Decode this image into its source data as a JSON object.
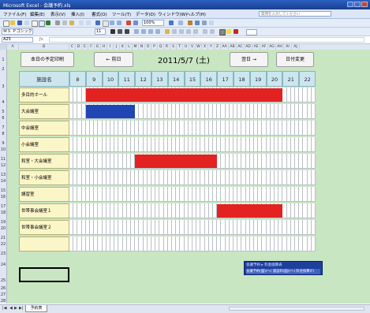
{
  "window": {
    "title": "Microsoft Excel - 会議予約.xls"
  },
  "menu": [
    "ファイル(F)",
    "編集(E)",
    "表示(V)",
    "挿入(I)",
    "書式(O)",
    "ツール(T)",
    "データ(D)",
    "ウィンドウ(W)",
    "ヘルプ(H)"
  ],
  "help_placeholder": "質問を入力してください",
  "toolbar": {
    "zoom": "100%",
    "font": "ＭＳ Ｐゴシック",
    "size": "11"
  },
  "formula": {
    "name_box": "A25"
  },
  "columns": [
    "A",
    "B",
    "C",
    "D",
    "E",
    "F",
    "G",
    "H",
    "I",
    "J",
    "K",
    "L",
    "M",
    "N",
    "O",
    "P",
    "Q",
    "R",
    "S",
    "T",
    "U",
    "V",
    "W",
    "X",
    "Y",
    "Z",
    "AA",
    "AB",
    "AC",
    "AD",
    "AE",
    "AF",
    "AG",
    "AH",
    "AI",
    "AJ"
  ],
  "rows": [
    "1",
    "2",
    "3",
    "4",
    "5",
    "6",
    "7",
    "8",
    "9",
    "10",
    "11",
    "12",
    "13",
    "14",
    "15",
    "16",
    "17",
    "18",
    "19",
    "20",
    "21",
    "22",
    "23",
    "24",
    "25",
    "26",
    "27",
    "28"
  ],
  "controls": {
    "today_label": "本日の予定印刷",
    "prev_label": "← 前日",
    "date": "2011/5/7 (土)",
    "next_label": "翌日 →",
    "change_label": "日付変更"
  },
  "schedule": {
    "header": "施設名",
    "hours": [
      "8",
      "9",
      "10",
      "11",
      "12",
      "13",
      "14",
      "15",
      "16",
      "17",
      "18",
      "19",
      "20",
      "21",
      "22"
    ],
    "rooms": [
      {
        "name": "多目的ホール",
        "bars": [
          {
            "start": 9,
            "end": 21,
            "color": "#e32222"
          }
        ]
      },
      {
        "name": "大会議室",
        "bars": [
          {
            "start": 9,
            "end": 12,
            "color": "#2046b5"
          }
        ]
      },
      {
        "name": "中会議室",
        "bars": []
      },
      {
        "name": "小会議室",
        "bars": []
      },
      {
        "name": "和室・大会議室",
        "bars": [
          {
            "start": 12,
            "end": 17,
            "color": "#e32222"
          }
        ]
      },
      {
        "name": "和室・小会議室",
        "bars": []
      },
      {
        "name": "講習室",
        "bars": []
      },
      {
        "name": "世帯事会議室１",
        "bars": [
          {
            "start": 17,
            "end": 21,
            "color": "#e32222"
          }
        ]
      },
      {
        "name": "世帯事会議室２",
        "bars": []
      },
      {
        "name": "",
        "bars": []
      }
    ]
  },
  "popup": {
    "title": "会議予約 ▸ 料金換算表",
    "body": "会議予約(図)(ヘ) 施設料(図)(ヘ) 料金換算(F)"
  },
  "sheet_tab": "予約表"
}
